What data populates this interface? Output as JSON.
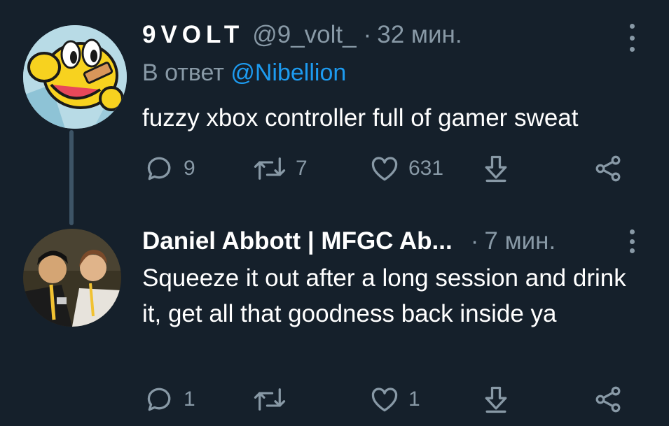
{
  "tweets": [
    {
      "name": "9VOLT",
      "handle": "@9_volt_",
      "separator": "·",
      "time": "32 мин.",
      "reply_prefix": "В ответ",
      "reply_mention": "@Nibellion",
      "body": "fuzzy xbox controller full of gamer sweat",
      "reply_count": "9",
      "retweet_count": "7",
      "like_count": "631"
    },
    {
      "name": "Daniel Abbott | MFGC Ab...",
      "separator": "·",
      "time": "7 мин.",
      "body": "Squeeze it out after a long session and drink it, get all that goodness back inside ya",
      "reply_count": "1",
      "like_count": "1"
    }
  ],
  "colors": {
    "background": "#15202b",
    "text": "#ffffff",
    "secondary": "#8899a6",
    "link": "#1d9bf0",
    "thread_line": "#3d5466"
  },
  "icons": [
    "reply-icon",
    "retweet-icon",
    "like-icon",
    "download-icon",
    "share-icon",
    "more-icon"
  ]
}
